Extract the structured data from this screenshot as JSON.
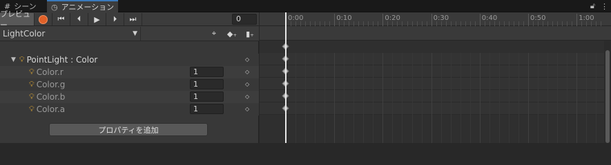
{
  "tabs": [
    {
      "label": "シーン",
      "icon": "grid-icon"
    },
    {
      "label": "アニメーション",
      "icon": "clock-icon"
    }
  ],
  "window_controls": {
    "lock": "lock-icon",
    "menu": "kebab-icon"
  },
  "toolbar": {
    "preview_label": "プレビュー",
    "frame_value": "0"
  },
  "clip": {
    "selected": "LightColor"
  },
  "properties": {
    "group": {
      "label": "PointLight : Color"
    },
    "items": [
      {
        "label": "Color.r",
        "value": "1"
      },
      {
        "label": "Color.g",
        "value": "1"
      },
      {
        "label": "Color.b",
        "value": "1"
      },
      {
        "label": "Color.a",
        "value": "1"
      }
    ]
  },
  "add_property_label": "プロパティを追加",
  "timeline": {
    "ticks": [
      "0:00",
      "0:10",
      "0:20",
      "0:30",
      "0:40",
      "0:50",
      "1:00"
    ]
  },
  "colors": {
    "accent": "#3a79bb",
    "record": "#e06028",
    "bulb": "#f2b533"
  }
}
